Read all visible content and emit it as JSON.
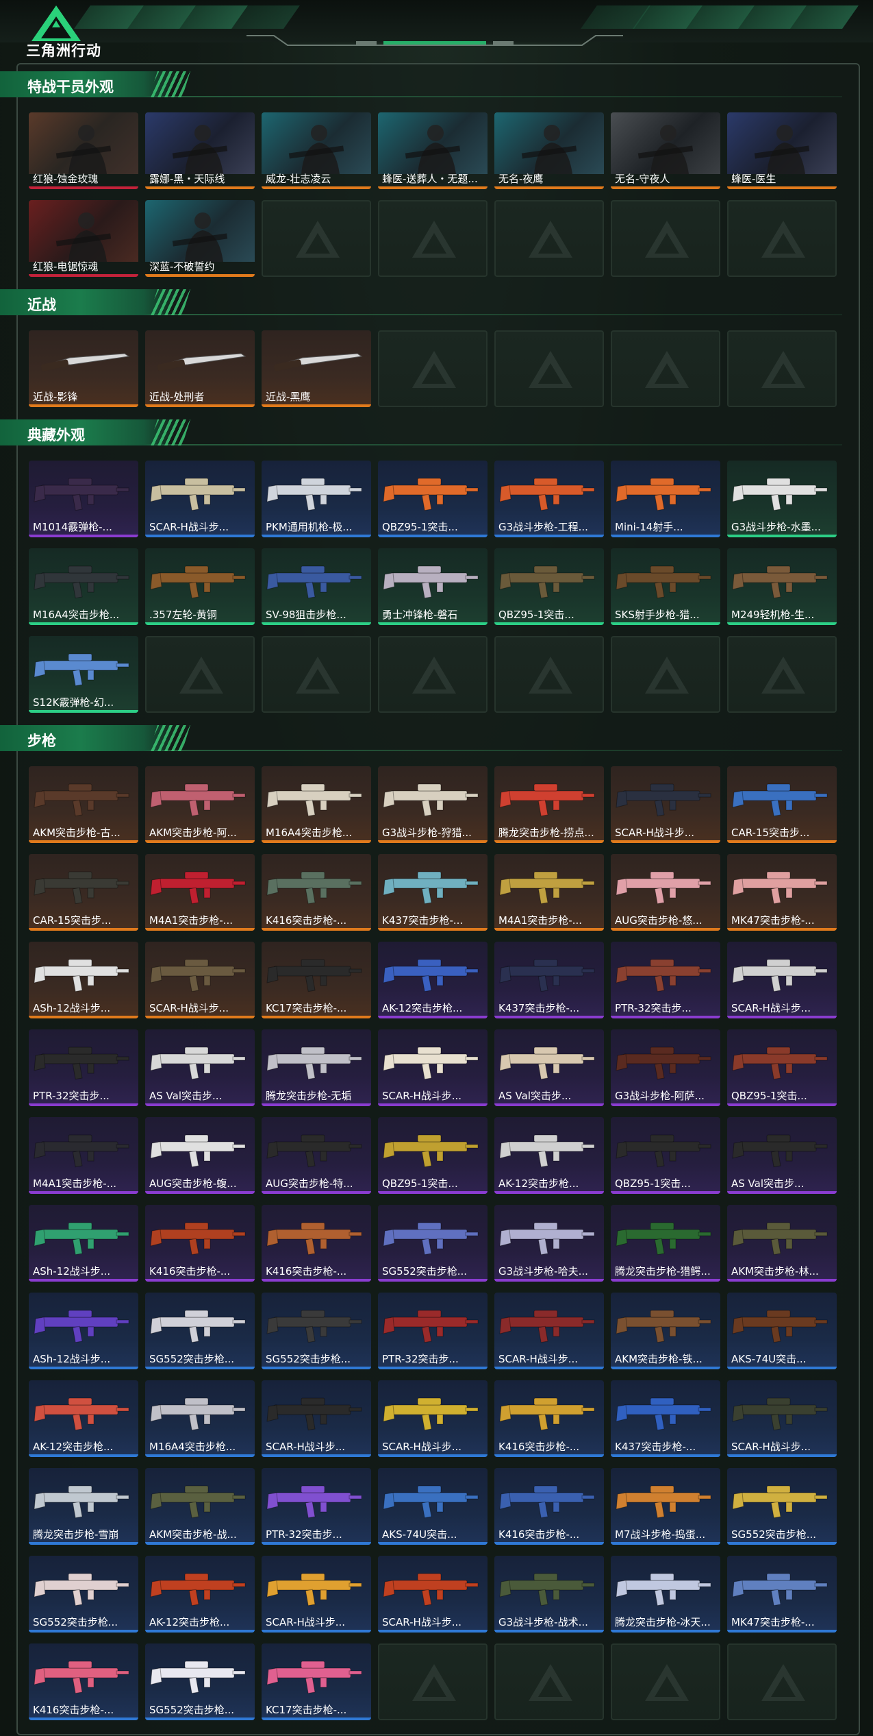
{
  "app": {
    "brand": "三角洲行动"
  },
  "sections": [
    {
      "title": "特战干员外观",
      "cols": 7,
      "items": [
        {
          "label": "红狼-蚀金玫瑰",
          "rarity": "red",
          "kind": "agent",
          "tone": "brown"
        },
        {
          "label": "露娜-黑・天际线",
          "rarity": "orange",
          "kind": "agent",
          "tone": "blue"
        },
        {
          "label": "威龙-壮志凌云",
          "rarity": "orange",
          "kind": "agent",
          "tone": "teal"
        },
        {
          "label": "蜂医-送葬人・无题...",
          "rarity": "orange",
          "kind": "agent",
          "tone": "teal"
        },
        {
          "label": "无名-夜鹰",
          "rarity": "orange",
          "kind": "agent",
          "tone": "teal"
        },
        {
          "label": "无名-守夜人",
          "rarity": "orange",
          "kind": "agent",
          "tone": "grey"
        },
        {
          "label": "蜂医-医生",
          "rarity": "orange",
          "kind": "agent",
          "tone": "blue"
        },
        {
          "label": "红狼-电锯惊魂",
          "rarity": "red",
          "kind": "agent",
          "tone": "red"
        },
        {
          "label": "深蓝-不破誓约",
          "rarity": "orange",
          "kind": "agent",
          "tone": "teal"
        }
      ],
      "slots": 14
    },
    {
      "title": "近战",
      "cols": 7,
      "items": [
        {
          "label": "近战-影锋",
          "rarity": "orange",
          "kind": "knife",
          "bg": "orange"
        },
        {
          "label": "近战-处刑者",
          "rarity": "orange",
          "kind": "knife",
          "bg": "orange"
        },
        {
          "label": "近战-黑鹰",
          "rarity": "orange",
          "kind": "knife",
          "bg": "orange"
        }
      ],
      "slots": 7
    },
    {
      "title": "典藏外观",
      "cols": 7,
      "items": [
        {
          "label": "M1014霰弹枪-...",
          "rarity": "purple",
          "bg": "purple",
          "gun": "#3a2a4a"
        },
        {
          "label": "SCAR-H战斗步...",
          "rarity": "blue",
          "bg": "blue",
          "gun": "#c8bfa0"
        },
        {
          "label": "PKM通用机枪-极...",
          "rarity": "blue",
          "bg": "blue",
          "gun": "#cfd4dc"
        },
        {
          "label": "QBZ95-1突击...",
          "rarity": "blue",
          "bg": "blue",
          "gun": "#e06a2a"
        },
        {
          "label": "G3战斗步枪-工程...",
          "rarity": "blue",
          "bg": "blue",
          "gun": "#d85a2a"
        },
        {
          "label": "Mini-14射手...",
          "rarity": "blue",
          "bg": "blue",
          "gun": "#e06a2a"
        },
        {
          "label": "G3战斗步枪-水墨...",
          "rarity": "green",
          "bg": "green",
          "gun": "#e0e0e0"
        },
        {
          "label": "M16A4突击步枪...",
          "rarity": "green",
          "bg": "green",
          "gun": "#30363a"
        },
        {
          "label": ".357左轮-黄铜",
          "rarity": "green",
          "bg": "green",
          "gun": "#8a5a2a"
        },
        {
          "label": "SV-98狙击步枪...",
          "rarity": "green",
          "bg": "green",
          "gun": "#3a5aa0"
        },
        {
          "label": "勇士冲锋枪-磐石",
          "rarity": "green",
          "bg": "green",
          "gun": "#b8b0c0"
        },
        {
          "label": "QBZ95-1突击...",
          "rarity": "green",
          "bg": "green",
          "gun": "#6a5a3a"
        },
        {
          "label": "SKS射手步枪-猎...",
          "rarity": "green",
          "bg": "green",
          "gun": "#6a4a2a"
        },
        {
          "label": "M249轻机枪-生...",
          "rarity": "green",
          "bg": "green",
          "gun": "#7a5a3a"
        },
        {
          "label": "S12K霰弹枪-幻...",
          "rarity": "green",
          "bg": "green",
          "gun": "#5a8ad0"
        }
      ],
      "slots": 21
    },
    {
      "title": "步枪",
      "cols": 7,
      "items": [
        {
          "label": "AKM突击步枪-古...",
          "rarity": "orange",
          "bg": "orange",
          "gun": "#5a3a2a"
        },
        {
          "label": "AKM突击步枪-阿...",
          "rarity": "orange",
          "bg": "orange",
          "gun": "#c06070"
        },
        {
          "label": "M16A4突击步枪...",
          "rarity": "orange",
          "bg": "orange",
          "gun": "#d8d0c0"
        },
        {
          "label": "G3战斗步枪-狩猎...",
          "rarity": "orange",
          "bg": "orange",
          "gun": "#d8d0c0"
        },
        {
          "label": "腾龙突击步枪-捞点...",
          "rarity": "orange",
          "bg": "orange",
          "gun": "#d04030"
        },
        {
          "label": "SCAR-H战斗步...",
          "rarity": "orange",
          "bg": "orange",
          "gun": "#2a3040"
        },
        {
          "label": "CAR-15突击步...",
          "rarity": "orange",
          "bg": "orange",
          "gun": "#3a70c0"
        },
        {
          "label": "CAR-15突击步...",
          "rarity": "orange",
          "bg": "orange",
          "gun": "#3a3a34"
        },
        {
          "label": "M4A1突击步枪-...",
          "rarity": "orange",
          "bg": "orange",
          "gun": "#c02030"
        },
        {
          "label": "K416突击步枪-...",
          "rarity": "orange",
          "bg": "orange",
          "gun": "#5a7060"
        },
        {
          "label": "K437突击步枪-...",
          "rarity": "orange",
          "bg": "orange",
          "gun": "#70b0c0"
        },
        {
          "label": "M4A1突击步枪-...",
          "rarity": "orange",
          "bg": "orange",
          "gun": "#c0a040"
        },
        {
          "label": "AUG突击步枪-悠...",
          "rarity": "orange",
          "bg": "orange",
          "gun": "#e0a0a8"
        },
        {
          "label": "MK47突击步枪-...",
          "rarity": "orange",
          "bg": "orange",
          "gun": "#e0a0a0"
        },
        {
          "label": "ASh-12战斗步...",
          "rarity": "orange",
          "bg": "orange",
          "gun": "#e0e0e0"
        },
        {
          "label": "SCAR-H战斗步...",
          "rarity": "orange",
          "bg": "orange",
          "gun": "#6a5a40"
        },
        {
          "label": "KC17突击步枪-...",
          "rarity": "orange",
          "bg": "orange",
          "gun": "#2a2a2a"
        },
        {
          "label": "AK-12突击步枪...",
          "rarity": "purple",
          "bg": "purple",
          "gun": "#3a60c0"
        },
        {
          "label": "K437突击步枪-...",
          "rarity": "purple",
          "bg": "purple",
          "gun": "#2a3050"
        },
        {
          "label": "PTR-32突击步...",
          "rarity": "purple",
          "bg": "purple",
          "gun": "#8a4030"
        },
        {
          "label": "SCAR-H战斗步...",
          "rarity": "purple",
          "bg": "purple",
          "gun": "#d0d0d0"
        },
        {
          "label": "PTR-32突击步...",
          "rarity": "purple",
          "bg": "purple",
          "gun": "#2a2a2a"
        },
        {
          "label": "AS Val突击步...",
          "rarity": "purple",
          "bg": "purple",
          "gun": "#d8d8d8"
        },
        {
          "label": "腾龙突击步枪-无垢",
          "rarity": "purple",
          "bg": "purple",
          "gun": "#c0c0c8"
        },
        {
          "label": "SCAR-H战斗步...",
          "rarity": "purple",
          "bg": "purple",
          "gun": "#e8e0d0"
        },
        {
          "label": "AS Val突击步...",
          "rarity": "purple",
          "bg": "purple",
          "gun": "#d8c8b0"
        },
        {
          "label": "G3战斗步枪-阿萨...",
          "rarity": "purple",
          "bg": "purple",
          "gun": "#5a2a20"
        },
        {
          "label": "QBZ95-1突击...",
          "rarity": "purple",
          "bg": "purple",
          "gun": "#8a3a2a"
        },
        {
          "label": "M4A1突击步枪-...",
          "rarity": "purple",
          "bg": "purple",
          "gun": "#2a2a30"
        },
        {
          "label": "AUG突击步枪-蝮...",
          "rarity": "purple",
          "bg": "purple",
          "gun": "#e0e0e0"
        },
        {
          "label": "AUG突击步枪-特...",
          "rarity": "purple",
          "bg": "purple",
          "gun": "#2a2a2a"
        },
        {
          "label": "QBZ95-1突击...",
          "rarity": "purple",
          "bg": "purple",
          "gun": "#c0a030"
        },
        {
          "label": "AK-12突击步枪...",
          "rarity": "purple",
          "bg": "purple",
          "gun": "#d0d0d0"
        },
        {
          "label": "QBZ95-1突击...",
          "rarity": "purple",
          "bg": "purple",
          "gun": "#2a2a2a"
        },
        {
          "label": "AS Val突击步...",
          "rarity": "purple",
          "bg": "purple",
          "gun": "#2a2a2a"
        },
        {
          "label": "ASh-12战斗步...",
          "rarity": "purple",
          "bg": "purple",
          "gun": "#30a070"
        },
        {
          "label": "K416突击步枪-...",
          "rarity": "purple",
          "bg": "purple",
          "gun": "#b04020"
        },
        {
          "label": "K416突击步枪-...",
          "rarity": "purple",
          "bg": "purple",
          "gun": "#b06030"
        },
        {
          "label": "SG552突击步枪...",
          "rarity": "purple",
          "bg": "purple",
          "gun": "#6070c0"
        },
        {
          "label": "G3战斗步枪-哈夫...",
          "rarity": "purple",
          "bg": "purple",
          "gun": "#b0b0d0"
        },
        {
          "label": "腾龙突击步枪-猎鳄...",
          "rarity": "purple",
          "bg": "purple",
          "gun": "#2a6a30"
        },
        {
          "label": "AKM突击步枪-林...",
          "rarity": "purple",
          "bg": "purple",
          "gun": "#5a5a3a"
        },
        {
          "label": "ASh-12战斗步...",
          "rarity": "blue",
          "bg": "blue",
          "gun": "#6040c0"
        },
        {
          "label": "SG552突击步枪...",
          "rarity": "blue",
          "bg": "blue",
          "gun": "#d0d0d8"
        },
        {
          "label": "SG552突击步枪...",
          "rarity": "blue",
          "bg": "blue",
          "gun": "#3a3a3a"
        },
        {
          "label": "PTR-32突击步...",
          "rarity": "blue",
          "bg": "blue",
          "gun": "#9a2a2a"
        },
        {
          "label": "SCAR-H战斗步...",
          "rarity": "blue",
          "bg": "blue",
          "gun": "#8a2a2a"
        },
        {
          "label": "AKM突击步枪-铁...",
          "rarity": "blue",
          "bg": "blue",
          "gun": "#7a5030"
        },
        {
          "label": "AKS-74U突击...",
          "rarity": "blue",
          "bg": "blue",
          "gun": "#6a3a20"
        },
        {
          "label": "AK-12突击步枪...",
          "rarity": "blue",
          "bg": "blue",
          "gun": "#d05040"
        },
        {
          "label": "M16A4突击步枪...",
          "rarity": "blue",
          "bg": "blue",
          "gun": "#c0c0c8"
        },
        {
          "label": "SCAR-H战斗步...",
          "rarity": "blue",
          "bg": "blue",
          "gun": "#2a2a2a"
        },
        {
          "label": "SCAR-H战斗步...",
          "rarity": "blue",
          "bg": "blue",
          "gun": "#d0b030"
        },
        {
          "label": "K416突击步枪-...",
          "rarity": "blue",
          "bg": "blue",
          "gun": "#d0a030"
        },
        {
          "label": "K437突击步枪-...",
          "rarity": "blue",
          "bg": "blue",
          "gun": "#3060c0"
        },
        {
          "label": "SCAR-H战斗步...",
          "rarity": "blue",
          "bg": "blue",
          "gun": "#3a4030"
        },
        {
          "label": "腾龙突击步枪-雪崩",
          "rarity": "blue",
          "bg": "blue",
          "gun": "#c0c8d0"
        },
        {
          "label": "AKM突击步枪-战...",
          "rarity": "blue",
          "bg": "blue",
          "gun": "#5a6040"
        },
        {
          "label": "PTR-32突击步...",
          "rarity": "blue",
          "bg": "blue",
          "gun": "#8050d0"
        },
        {
          "label": "AKS-74U突击...",
          "rarity": "blue",
          "bg": "blue",
          "gun": "#3a70c0"
        },
        {
          "label": "K416突击步枪-...",
          "rarity": "blue",
          "bg": "blue",
          "gun": "#3a60b0"
        },
        {
          "label": "M7战斗步枪-捣蛋...",
          "rarity": "blue",
          "bg": "blue",
          "gun": "#d08030"
        },
        {
          "label": "SG552突击步枪...",
          "rarity": "blue",
          "bg": "blue",
          "gun": "#d0b040"
        },
        {
          "label": "SG552突击步枪...",
          "rarity": "blue",
          "bg": "blue",
          "gun": "#e0d0d0"
        },
        {
          "label": "AK-12突击步枪...",
          "rarity": "blue",
          "bg": "blue",
          "gun": "#c04020"
        },
        {
          "label": "SCAR-H战斗步...",
          "rarity": "blue",
          "bg": "blue",
          "gun": "#e0a030"
        },
        {
          "label": "SCAR-H战斗步...",
          "rarity": "blue",
          "bg": "blue",
          "gun": "#c04020"
        },
        {
          "label": "G3战斗步枪-战术...",
          "rarity": "blue",
          "bg": "blue",
          "gun": "#4a5a3a"
        },
        {
          "label": "腾龙突击步枪-冰天...",
          "rarity": "blue",
          "bg": "blue",
          "gun": "#c0c8e0"
        },
        {
          "label": "MK47突击步枪-...",
          "rarity": "blue",
          "bg": "blue",
          "gun": "#6080c0"
        },
        {
          "label": "K416突击步枪-...",
          "rarity": "blue",
          "bg": "blue",
          "gun": "#e06080"
        },
        {
          "label": "SG552突击步枪...",
          "rarity": "blue",
          "bg": "blue",
          "gun": "#e8e8f0"
        },
        {
          "label": "KC17突击步枪-...",
          "rarity": "blue",
          "bg": "blue",
          "gun": "#e06090"
        }
      ],
      "slots": 77
    }
  ],
  "colors": {
    "accent": "#1b7c4c",
    "red": "#c2223a",
    "orange": "#e07a1c",
    "purple": "#8a3cd0",
    "blue": "#2f79d6",
    "green": "#2ccf86"
  }
}
